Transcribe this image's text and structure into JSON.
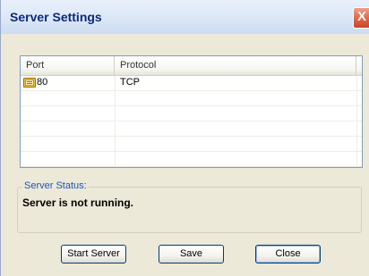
{
  "window": {
    "title": "Server Settings",
    "close_glyph": "X"
  },
  "ports_table": {
    "columns": [
      "Port",
      "Protocol"
    ],
    "rows": [
      {
        "port": "80",
        "protocol": "TCP",
        "icon": "network-port-icon"
      }
    ]
  },
  "status_group": {
    "legend": "Server Status:",
    "status": "Server is not running."
  },
  "buttons": {
    "start": "Start Server",
    "save": "Save",
    "close": "Close"
  },
  "colors": {
    "title_text": "#0b2a7a",
    "group_legend": "#1b52c5",
    "window_bg": "#ece9d8",
    "close_button": "#e06a4a"
  }
}
